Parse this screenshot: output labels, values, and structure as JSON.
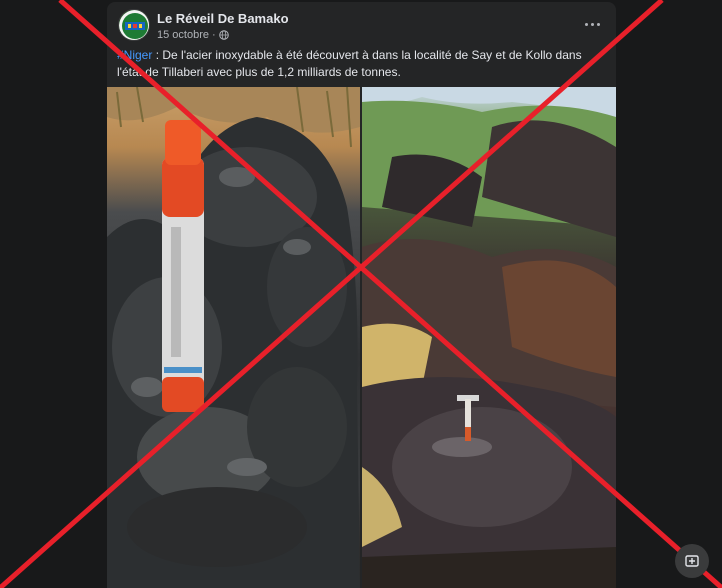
{
  "post": {
    "page_name": "Le Réveil De Bamako",
    "date": "15 octobre",
    "separator": "·",
    "hashtag": "#Niger",
    "caption": " : De l'acier inoxydable à été découvert à dans la localité de Say et de Kollo dans l'état de Tillaberi avec plus de 1,2 milliards de tonnes."
  },
  "icons": {
    "avatar": "page-logo",
    "privacy": "globe-icon",
    "more": "more-options-icon",
    "action": "screenshot-icon"
  },
  "colors": {
    "cross": "#e8202a",
    "link": "#4599ff",
    "background": "#18191a",
    "card": "#242526"
  }
}
